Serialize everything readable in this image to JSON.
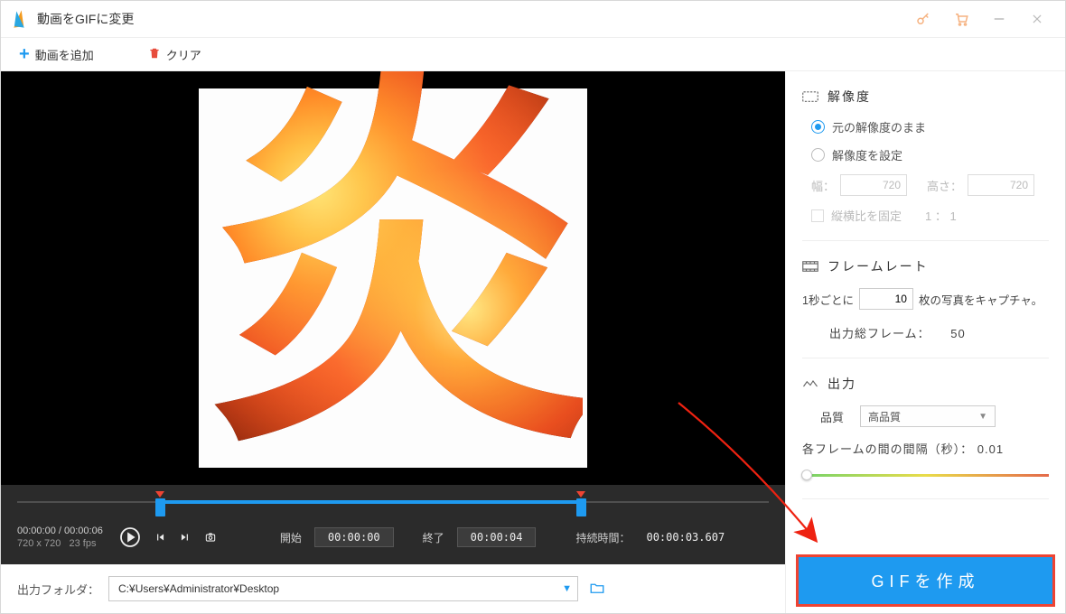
{
  "window": {
    "title": "動画をGIFに変更"
  },
  "toolbar": {
    "add_label": "動画を追加",
    "clear_label": "クリア"
  },
  "preview": {
    "glyph": "炎"
  },
  "player": {
    "cur_time": "00:00:00",
    "total_time": "00:00:06",
    "dimensions": "720 x 720",
    "fps": "23 fps",
    "start_label": "開始",
    "start_value": "00:00:00",
    "end_label": "終了",
    "end_value": "00:00:04",
    "duration_label": "持続時間：",
    "duration_value": "00:00:03.607",
    "sel_start_pct": 19,
    "sel_end_pct": 75
  },
  "output_folder": {
    "label": "出力フォルダ：",
    "path": "C:¥Users¥Administrator¥Desktop"
  },
  "resolution": {
    "heading": "解像度",
    "keep_original": "元の解像度のまま",
    "set_manual": "解像度を設定",
    "width_label": "幅：",
    "width_value": "720",
    "height_label": "高さ：",
    "height_value": "720",
    "lock_ratio": "縦横比を固定",
    "ratio_text": "1 ： 1"
  },
  "framerate": {
    "heading": "フレームレート",
    "prefix": "1秒ごとに",
    "value": "10",
    "suffix": "枚の写真をキャプチャ。",
    "total_label": "出力総フレーム：",
    "total_value": "50"
  },
  "outputsect": {
    "heading": "出力",
    "quality_label": "品質",
    "quality_value": "高品質",
    "interval_label": "各フレームの間の間隔（秒）：",
    "interval_value": "0.01",
    "slider_pct": 2
  },
  "create_btn": "GIFを作成"
}
